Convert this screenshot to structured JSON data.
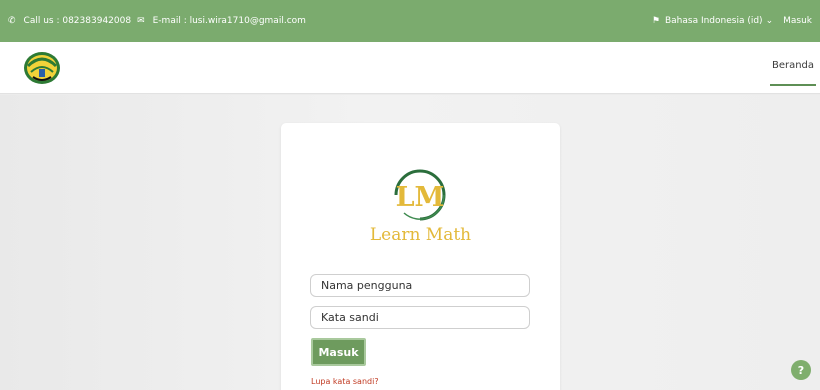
{
  "topbar": {
    "phone_icon": "phone-icon",
    "call_text": "Call us : 082383942008",
    "mail_icon": "mail-icon",
    "email_text": "E-mail : lusi.wira1710@gmail.com",
    "lang_icon": "language-flag-icon",
    "language": "Bahasa Indonesia (id)",
    "language_caret": "⌄",
    "login_link": "Masuk"
  },
  "navbar": {
    "logo_icon": "university-emblem-icon",
    "home_link": "Beranda"
  },
  "login_card": {
    "emblem_letters": "LM",
    "brand_name": "Learn Math",
    "username_placeholder": "Nama pengguna",
    "password_placeholder": "Kata sandi",
    "submit_label": "Masuk",
    "forgot_link": "Lupa kata sandi?"
  },
  "help_button": {
    "label": "?"
  },
  "colors": {
    "topbar": "#7bab6e",
    "button": "#6e9b5e",
    "brand_gold": "#e3b93a",
    "forgot_red": "#c03a22"
  }
}
